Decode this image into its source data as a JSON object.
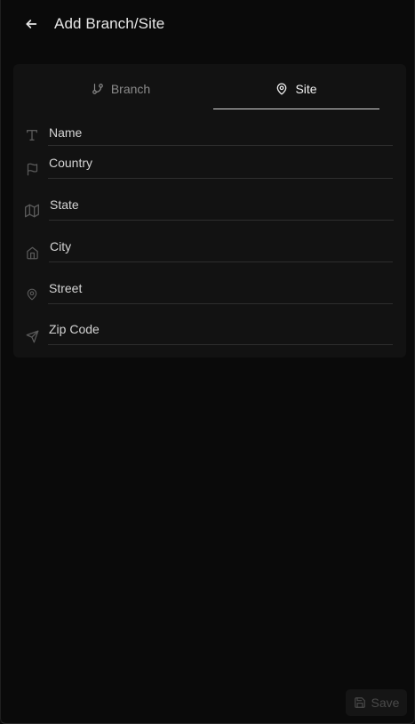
{
  "header": {
    "title": "Add Branch/Site",
    "back_icon": "arrow-left-icon"
  },
  "tabs": [
    {
      "label": "Branch",
      "icon": "git-branch-icon",
      "active": false
    },
    {
      "label": "Site",
      "icon": "map-pin-icon",
      "active": true
    }
  ],
  "fields": {
    "name": {
      "placeholder": "Name",
      "icon": "type-icon"
    },
    "country": {
      "placeholder": "Country",
      "icon": "flag-icon"
    },
    "state": {
      "placeholder": "State",
      "icon": "map-icon"
    },
    "city": {
      "placeholder": "City",
      "icon": "home-icon"
    },
    "street": {
      "placeholder": "Street",
      "icon": "map-pin-icon"
    },
    "zip": {
      "placeholder": "Zip Code",
      "icon": "send-icon"
    }
  },
  "footer": {
    "save_label": "Save",
    "save_icon": "save-icon",
    "save_enabled": false
  },
  "colors": {
    "background": "#0a0a0a",
    "card": "#121212",
    "active_tab_underline": "#d9d9d9",
    "muted_icon": "#555555"
  }
}
